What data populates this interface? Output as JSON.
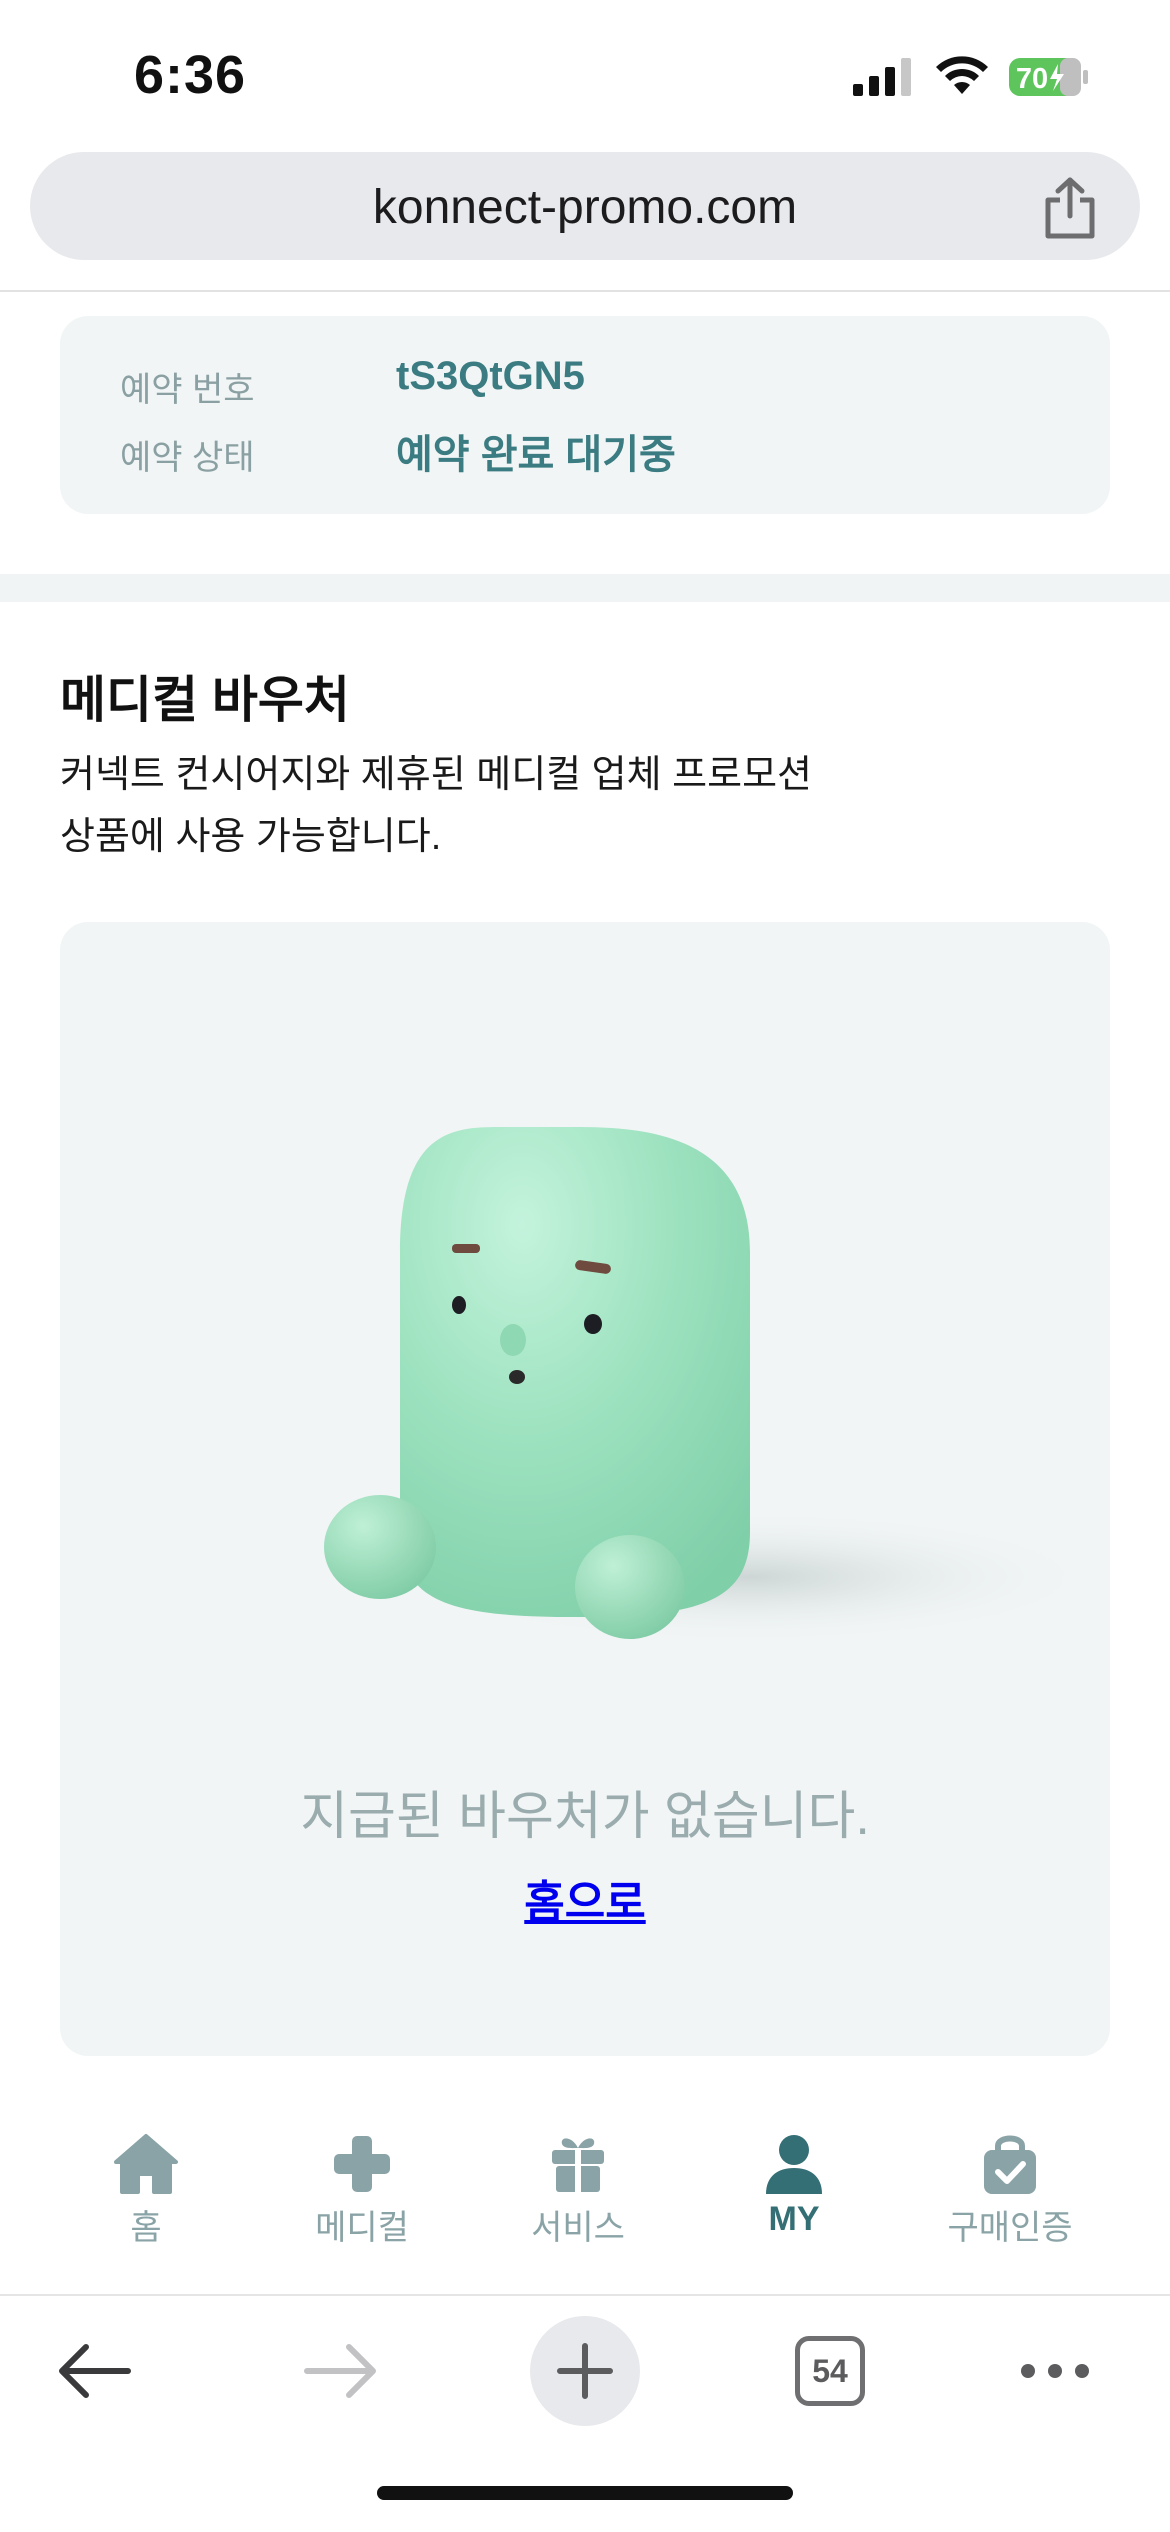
{
  "status_bar": {
    "time": "6:36",
    "battery": "70"
  },
  "browser": {
    "url": "konnect-promo.com",
    "tab_count": "54"
  },
  "reservation": {
    "number_label": "예약 번호",
    "number_value": "tS3QtGN5",
    "status_label": "예약 상태",
    "status_value": "예약 완료 대기중"
  },
  "voucher_section": {
    "title": "메디컬 바우처",
    "description_line1": "커넥트 컨시어지와 제휴된 메디컬 업체 프로모션",
    "description_line2": "상품에 사용 가능합니다.",
    "empty_message": "지급된 바우처가 없습니다.",
    "home_link": "홈으로"
  },
  "tab_bar": {
    "items": [
      {
        "label": "홈",
        "icon": "home-icon"
      },
      {
        "label": "메디컬",
        "icon": "medical-cross-icon"
      },
      {
        "label": "서비스",
        "icon": "gift-icon"
      },
      {
        "label": "MY",
        "icon": "user-icon"
      },
      {
        "label": "구매인증",
        "icon": "shopping-bag-check-icon"
      }
    ],
    "active_index": 3
  },
  "colors": {
    "accent": "#3b7c82",
    "muted_label": "#8aa0a3",
    "card_bg": "#f1f5f5",
    "link": "#0000ee",
    "battery": "#5ec55d"
  }
}
